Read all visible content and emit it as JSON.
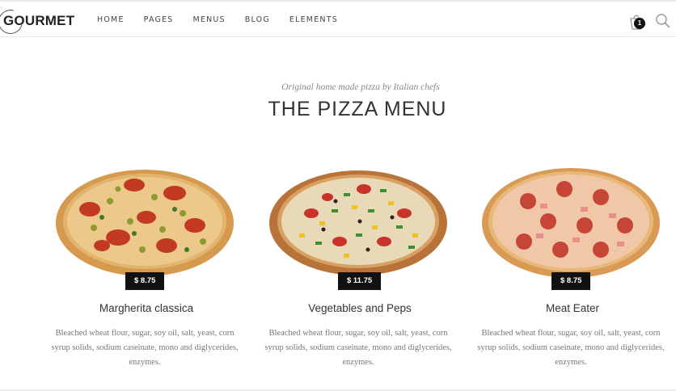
{
  "header": {
    "logo_text": "GOURMET",
    "nav": [
      "HOME",
      "PAGES",
      "MENUS",
      "BLOG",
      "ELEMENTS"
    ],
    "cart_count": "1",
    "cart_icon": "shopping-bag-icon",
    "search_icon": "search-icon"
  },
  "section": {
    "subtitle": "Original home made pizza by Italian chefs",
    "title": "THE PIZZA MENU"
  },
  "items": [
    {
      "name": "Margherita classica",
      "price": "$ 8.75",
      "description": "Bleached wheat flour, sugar, soy oil, salt, yeast, corn syrup solids, sodium caseinate, mono and diglycerides, enzymes."
    },
    {
      "name": "Vegetables and Peps",
      "price": "$ 11.75",
      "description": "Bleached wheat flour, sugar, soy oil, salt, yeast, corn syrup solids, sodium caseinate, mono and diglycerides, enzymes."
    },
    {
      "name": "Meat Eater",
      "price": "$ 8.75",
      "description": "Bleached wheat flour, sugar, soy oil, salt, yeast, corn syrup solids, sodium caseinate, mono and diglycerides, enzymes."
    }
  ],
  "colors": {
    "price_tag_bg": "#111111",
    "title_text": "#333333",
    "body_text": "#777777"
  }
}
